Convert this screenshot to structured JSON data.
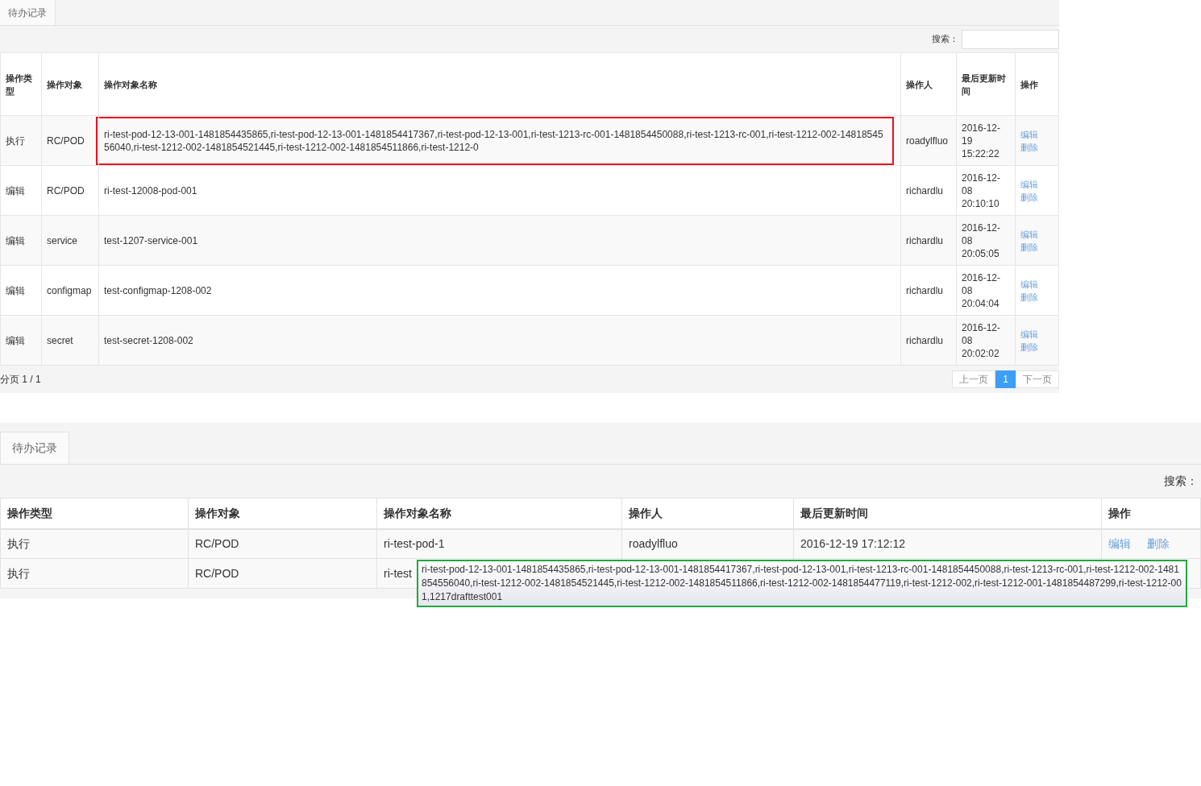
{
  "panels": [
    {
      "tab": {
        "label": "待办记录"
      },
      "search": {
        "label": "搜索："
      },
      "columns": [
        "操作类型",
        "操作对象",
        "操作对象名称",
        "操作人",
        "最后更新时间",
        "操作"
      ],
      "rows": [
        {
          "type": "执行",
          "object": "RC/POD",
          "name": "ri-test-pod-12-13-001-1481854435865,ri-test-pod-12-13-001-1481854417367,ri-test-pod-12-13-001,ri-test-1213-rc-001-1481854450088,ri-test-1213-rc-001,ri-test-1212-002-1481854556040,ri-test-1212-002-1481854521445,ri-test-1212-002-1481854511866,ri-test-1212-0",
          "operator": "roadylfluo",
          "time": "2016-12-19 15:22:22",
          "actions": [
            "编辑",
            "删除"
          ],
          "highlighted": true
        },
        {
          "type": "编辑",
          "object": "RC/POD",
          "name": "ri-test-12008-pod-001",
          "operator": "richardlu",
          "time": "2016-12-08 20:10:10",
          "actions": [
            "编辑",
            "删除"
          ],
          "highlighted": false
        },
        {
          "type": "编辑",
          "object": "service",
          "name": "test-1207-service-001",
          "operator": "richardlu",
          "time": "2016-12-08 20:05:05",
          "actions": [
            "编辑",
            "删除"
          ],
          "highlighted": false
        },
        {
          "type": "编辑",
          "object": "configmap",
          "name": "test-configmap-1208-002",
          "operator": "richardlu",
          "time": "2016-12-08 20:04:04",
          "actions": [
            "编辑",
            "删除"
          ],
          "highlighted": false
        },
        {
          "type": "编辑",
          "object": "secret",
          "name": "test-secret-1208-002",
          "operator": "richardlu",
          "time": "2016-12-08 20:02:02",
          "actions": [
            "编辑",
            "删除"
          ],
          "highlighted": false
        }
      ],
      "pagination": {
        "info": "分页 1 / 1",
        "prev": "上一页",
        "pages": [
          {
            "label": "1",
            "selected": true
          }
        ],
        "next": "下一页"
      }
    },
    {
      "tab": {
        "label": "待办记录"
      },
      "search": {
        "label": "搜索："
      },
      "columns": [
        "操作类型",
        "操作对象",
        "操作对象名称",
        "操作人",
        "最后更新时间",
        "操作"
      ],
      "rows": [
        {
          "type": "执行",
          "object": "RC/POD",
          "name": "ri-test-pod-1",
          "operator": "roadylfluo",
          "time": "2016-12-19 17:12:12",
          "actions": [
            "编辑",
            "删除"
          ]
        },
        {
          "type": "执行",
          "object": "RC/POD",
          "name": "ri-test"
        }
      ],
      "tooltip": {
        "text": "ri-test-pod-12-13-001-1481854435865,ri-test-pod-12-13-001-1481854417367,ri-test-pod-12-13-001,ri-test-1213-rc-001-1481854450088,ri-test-1213-rc-001,ri-test-1212-002-1481854556040,ri-test-1212-002-1481854521445,ri-test-1212-002-1481854511866,ri-test-1212-002-1481854477119,ri-test-1212-002,ri-test-1212-001-1481854487299,ri-test-1212-001,1217drafttest001"
      }
    }
  ]
}
